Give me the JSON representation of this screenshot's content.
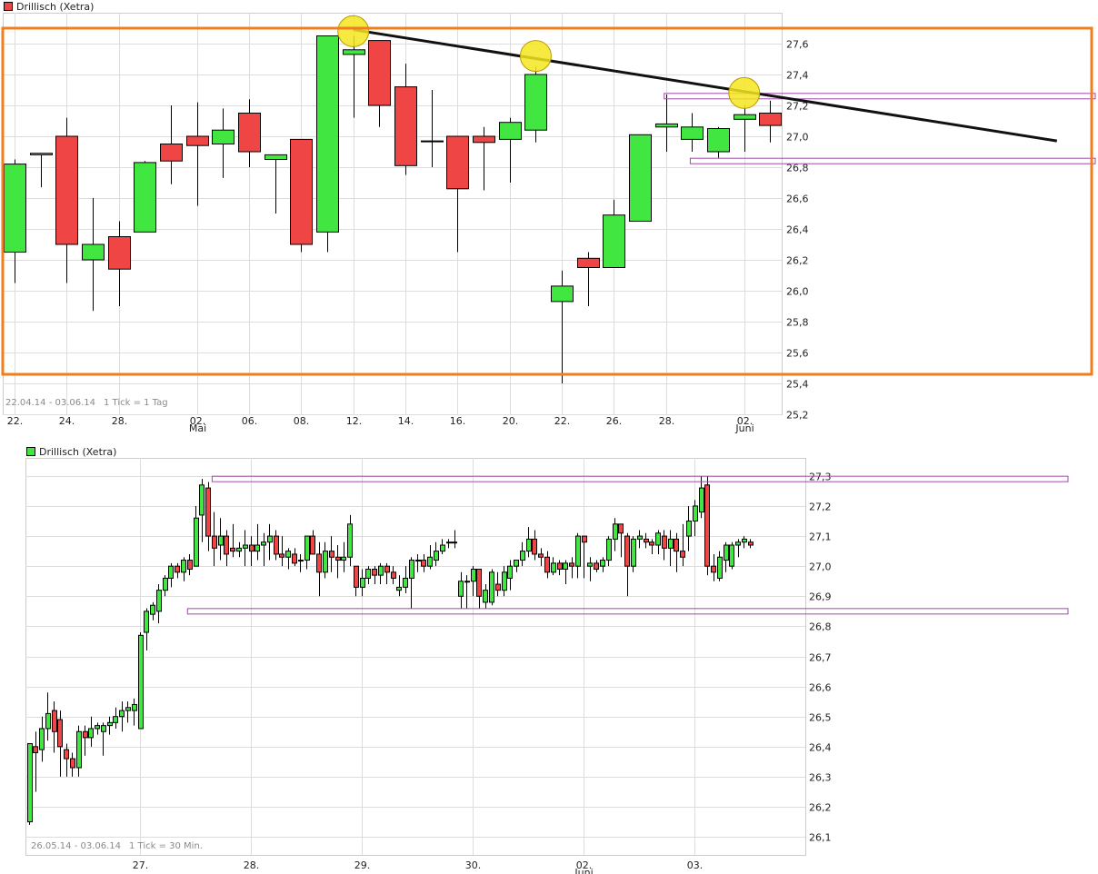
{
  "colors": {
    "up": "#41e641",
    "down": "#f04545",
    "grid": "#dddddd",
    "frame": "#cccccc",
    "annot_orange": "#f07d1e",
    "annot_yellow": "#f5e51e",
    "channel": "#a04aa8"
  },
  "chart_data": [
    {
      "type": "candlestick",
      "legend": "Drillisch (Xetra)",
      "range_text": "22.04.14 - 03.06.14",
      "tick_text": "1 Tick = 1 Tag",
      "ylim": [
        25.2,
        27.8
      ],
      "yticks": [
        "25,2",
        "25,4",
        "25,6",
        "25,8",
        "26,0",
        "26,2",
        "26,4",
        "26,6",
        "26,8",
        "27,0",
        "27,2",
        "27,4",
        "27,6"
      ],
      "xticks": [
        {
          "label": "22.",
          "i": 0
        },
        {
          "label": "24.",
          "i": 2
        },
        {
          "label": "28.",
          "i": 4
        },
        {
          "label": "02.",
          "sub": "Mai",
          "i": 7
        },
        {
          "label": "06.",
          "i": 9
        },
        {
          "label": "08.",
          "i": 11
        },
        {
          "label": "12.",
          "i": 13
        },
        {
          "label": "14.",
          "i": 15
        },
        {
          "label": "16.",
          "i": 17
        },
        {
          "label": "20.",
          "i": 19
        },
        {
          "label": "22.",
          "i": 21
        },
        {
          "label": "26.",
          "i": 23
        },
        {
          "label": "28.",
          "i": 25
        },
        {
          "label": "02.",
          "sub": "Juni",
          "i": 28
        }
      ],
      "candles": [
        [
          26.25,
          26.82,
          26.05,
          26.85
        ],
        [
          26.88,
          26.89,
          26.67,
          26.89
        ],
        [
          27.0,
          26.3,
          26.05,
          27.12
        ],
        [
          26.2,
          26.3,
          25.87,
          26.6
        ],
        [
          26.35,
          26.14,
          25.9,
          26.45
        ],
        [
          26.38,
          26.83,
          26.38,
          26.84
        ],
        [
          26.95,
          26.84,
          26.69,
          27.2
        ],
        [
          27.0,
          26.94,
          26.55,
          27.22
        ],
        [
          26.95,
          27.04,
          26.73,
          27.18
        ],
        [
          27.15,
          26.9,
          26.8,
          27.24
        ],
        [
          26.85,
          26.88,
          26.5,
          26.88
        ],
        [
          26.98,
          26.3,
          26.25,
          26.98
        ],
        [
          26.38,
          27.65,
          26.25,
          27.65
        ],
        [
          27.53,
          27.56,
          27.12,
          27.65
        ],
        [
          27.62,
          27.2,
          27.06,
          27.62
        ],
        [
          27.32,
          26.81,
          26.75,
          27.47
        ],
        [
          26.97,
          26.97,
          26.8,
          27.3
        ],
        [
          27.0,
          26.66,
          26.25,
          27.0
        ],
        [
          27.0,
          26.96,
          26.65,
          27.06
        ],
        [
          26.98,
          27.09,
          26.7,
          27.12
        ],
        [
          27.04,
          27.4,
          26.96,
          27.45
        ],
        [
          25.93,
          26.03,
          25.4,
          26.13
        ],
        [
          26.21,
          26.15,
          25.9,
          26.25
        ],
        [
          26.15,
          26.49,
          26.15,
          26.59
        ],
        [
          26.45,
          27.01,
          26.45,
          27.01
        ],
        [
          27.06,
          27.08,
          26.9,
          27.27
        ],
        [
          26.98,
          27.06,
          26.9,
          27.15
        ],
        [
          26.9,
          27.05,
          26.86,
          27.06
        ],
        [
          27.11,
          27.14,
          26.9,
          27.2
        ],
        [
          27.15,
          27.07,
          26.96,
          27.23
        ]
      ],
      "trendline": [
        [
          13,
          27.69
        ],
        [
          40,
          26.97
        ]
      ],
      "highlights": [
        [
          13,
          27.68
        ],
        [
          20,
          27.52
        ],
        [
          28,
          27.28
        ]
      ],
      "channels": [
        [
          25,
          27.26
        ],
        [
          26,
          26.84
        ]
      ]
    },
    {
      "type": "candlestick",
      "legend": "Drillisch (Xetra)",
      "range_text": "26.05.14 - 03.06.14",
      "tick_text": "1 Tick = 30 Min.",
      "ylim": [
        26.04,
        27.36
      ],
      "yticks": [
        "26,1",
        "26,2",
        "26,3",
        "26,4",
        "26,5",
        "26,6",
        "26,7",
        "26,8",
        "26,9",
        "27,0",
        "27,1",
        "27,2",
        "27,3"
      ],
      "xticks": [
        {
          "label": "27.",
          "i": 18
        },
        {
          "label": "28.",
          "i": 36
        },
        {
          "label": "29.",
          "i": 54
        },
        {
          "label": "30.",
          "i": 72
        },
        {
          "label": "02.",
          "sub": "Juni",
          "i": 90
        },
        {
          "label": "03.",
          "i": 108
        }
      ],
      "candles": [
        [
          26.15,
          26.41,
          26.14,
          26.41
        ],
        [
          26.4,
          26.38,
          26.25,
          26.45
        ],
        [
          26.39,
          26.46,
          26.35,
          26.5
        ],
        [
          26.46,
          26.51,
          26.42,
          26.58
        ],
        [
          26.52,
          26.45,
          26.38,
          26.55
        ],
        [
          26.49,
          26.4,
          26.3,
          26.52
        ],
        [
          26.39,
          26.36,
          26.3,
          26.41
        ],
        [
          26.36,
          26.33,
          26.3,
          26.38
        ],
        [
          26.33,
          26.45,
          26.3,
          26.47
        ],
        [
          26.45,
          26.43,
          26.37,
          26.47
        ],
        [
          26.43,
          26.46,
          26.4,
          26.5
        ],
        [
          26.46,
          26.47,
          26.44,
          26.48
        ],
        [
          26.45,
          26.47,
          26.37,
          26.48
        ],
        [
          26.47,
          26.48,
          26.44,
          26.5
        ],
        [
          26.48,
          26.5,
          26.46,
          26.53
        ],
        [
          26.5,
          26.52,
          26.45,
          26.55
        ],
        [
          26.52,
          26.53,
          26.48,
          26.55
        ],
        [
          26.52,
          26.54,
          26.47,
          26.56
        ],
        [
          26.46,
          26.77,
          26.46,
          26.78
        ],
        [
          26.78,
          26.85,
          26.72,
          26.86
        ],
        [
          26.84,
          26.87,
          26.82,
          26.88
        ],
        [
          26.85,
          26.92,
          26.81,
          26.94
        ],
        [
          26.92,
          26.96,
          26.9,
          26.97
        ],
        [
          26.96,
          27.0,
          26.93,
          27.01
        ],
        [
          27.0,
          26.98,
          26.96,
          27.01
        ],
        [
          26.98,
          27.02,
          26.95,
          27.03
        ],
        [
          27.02,
          26.99,
          26.97,
          27.04
        ],
        [
          27.0,
          27.16,
          27.0,
          27.2
        ],
        [
          27.17,
          27.27,
          27.08,
          27.29
        ],
        [
          27.26,
          27.1,
          27.05,
          27.28
        ],
        [
          27.1,
          27.06,
          27.0,
          27.18
        ],
        [
          27.07,
          27.1,
          27.02,
          27.16
        ],
        [
          27.1,
          27.04,
          27.0,
          27.12
        ],
        [
          27.06,
          27.05,
          27.03,
          27.14
        ],
        [
          27.05,
          27.06,
          27.03,
          27.08
        ],
        [
          27.06,
          27.07,
          27.0,
          27.12
        ],
        [
          27.07,
          27.05,
          27.0,
          27.1
        ],
        [
          27.05,
          27.07,
          27.02,
          27.14
        ],
        [
          27.07,
          27.08,
          27.0,
          27.11
        ],
        [
          27.08,
          27.1,
          27.02,
          27.14
        ],
        [
          27.1,
          27.04,
          27.02,
          27.12
        ],
        [
          27.04,
          27.03,
          27.0,
          27.1
        ],
        [
          27.03,
          27.05,
          26.99,
          27.06
        ],
        [
          27.04,
          27.01,
          27.0,
          27.06
        ],
        [
          27.02,
          27.02,
          26.98,
          27.04
        ],
        [
          27.02,
          27.1,
          26.99,
          27.1
        ],
        [
          27.1,
          27.04,
          27.04,
          27.12
        ],
        [
          27.04,
          26.98,
          26.9,
          27.08
        ],
        [
          26.98,
          27.05,
          26.96,
          27.08
        ],
        [
          27.05,
          27.03,
          26.98,
          27.1
        ],
        [
          27.03,
          27.02,
          26.96,
          27.07
        ],
        [
          27.02,
          27.03,
          26.98,
          27.08
        ],
        [
          27.03,
          27.14,
          27.0,
          27.17
        ],
        [
          27.0,
          26.93,
          26.9,
          27.0
        ],
        [
          26.93,
          26.96,
          26.9,
          26.99
        ],
        [
          26.96,
          26.99,
          26.94,
          27.0
        ],
        [
          26.99,
          26.97,
          26.94,
          27.0
        ],
        [
          26.97,
          27.0,
          26.94,
          27.01
        ],
        [
          27.0,
          26.98,
          26.94,
          27.01
        ],
        [
          26.98,
          26.96,
          26.94,
          27.0
        ],
        [
          26.92,
          26.93,
          26.9,
          26.97
        ],
        [
          26.93,
          26.96,
          26.91,
          27.0
        ],
        [
          26.96,
          27.02,
          26.86,
          27.03
        ],
        [
          27.02,
          27.02,
          26.98,
          27.04
        ],
        [
          27.02,
          27.0,
          26.98,
          27.04
        ],
        [
          27.0,
          27.03,
          26.99,
          27.07
        ],
        [
          27.02,
          27.05,
          27.0,
          27.08
        ],
        [
          27.05,
          27.07,
          27.04,
          27.09
        ],
        [
          27.08,
          27.08,
          27.06,
          27.09
        ],
        [
          27.08,
          27.08,
          27.06,
          27.12
        ],
        [
          26.9,
          26.95,
          26.86,
          26.98
        ],
        [
          26.95,
          26.95,
          26.86,
          26.97
        ],
        [
          26.95,
          26.99,
          26.9,
          27.0
        ],
        [
          26.99,
          26.9,
          26.86,
          26.99
        ],
        [
          26.88,
          26.92,
          26.86,
          26.94
        ],
        [
          26.88,
          26.98,
          26.87,
          26.99
        ],
        [
          26.94,
          26.92,
          26.9,
          26.98
        ],
        [
          26.92,
          26.98,
          26.9,
          27.0
        ],
        [
          26.96,
          27.0,
          26.92,
          27.02
        ],
        [
          27.0,
          27.02,
          26.98,
          27.02
        ],
        [
          27.02,
          27.05,
          27.0,
          27.08
        ],
        [
          27.05,
          27.09,
          27.03,
          27.13
        ],
        [
          27.09,
          27.04,
          27.02,
          27.12
        ],
        [
          27.04,
          27.03,
          27.0,
          27.06
        ],
        [
          27.03,
          26.98,
          26.96,
          27.05
        ],
        [
          26.98,
          27.01,
          26.97,
          27.03
        ],
        [
          27.01,
          26.99,
          26.97,
          27.02
        ],
        [
          26.99,
          27.01,
          26.94,
          27.02
        ],
        [
          27.01,
          27.0,
          26.96,
          27.03
        ],
        [
          27.0,
          27.1,
          26.96,
          27.11
        ],
        [
          27.1,
          27.08,
          26.96,
          27.1
        ],
        [
          27.0,
          27.01,
          26.95,
          27.03
        ],
        [
          27.01,
          26.99,
          26.98,
          27.02
        ],
        [
          27.0,
          27.02,
          26.98,
          27.03
        ],
        [
          27.02,
          27.09,
          27.0,
          27.1
        ],
        [
          27.09,
          27.14,
          27.05,
          27.16
        ],
        [
          27.14,
          27.11,
          27.03,
          27.14
        ],
        [
          27.1,
          27.0,
          26.9,
          27.11
        ],
        [
          27.0,
          27.09,
          26.98,
          27.1
        ],
        [
          27.09,
          27.1,
          27.06,
          27.12
        ],
        [
          27.09,
          27.08,
          27.06,
          27.11
        ],
        [
          27.08,
          27.07,
          27.04,
          27.09
        ],
        [
          27.07,
          27.11,
          27.04,
          27.12
        ],
        [
          27.1,
          27.06,
          27.02,
          27.12
        ],
        [
          27.06,
          27.09,
          27.0,
          27.12
        ],
        [
          27.09,
          27.05,
          26.98,
          27.11
        ],
        [
          27.05,
          27.03,
          27.0,
          27.14
        ],
        [
          27.1,
          27.15,
          27.05,
          27.2
        ],
        [
          27.15,
          27.2,
          27.1,
          27.22
        ],
        [
          27.18,
          27.26,
          27.16,
          27.3
        ],
        [
          27.27,
          27.0,
          26.97,
          27.3
        ],
        [
          27.0,
          26.98,
          26.95,
          27.04
        ],
        [
          26.96,
          27.03,
          26.95,
          27.05
        ],
        [
          27.02,
          27.07,
          26.98,
          27.08
        ],
        [
          27.0,
          27.07,
          26.99,
          27.08
        ],
        [
          27.07,
          27.08,
          27.03,
          27.09
        ],
        [
          27.08,
          27.09,
          27.06,
          27.1
        ],
        [
          27.08,
          27.07,
          27.06,
          27.09
        ]
      ],
      "channels": [
        [
          30,
          27.29
        ],
        [
          26,
          26.85
        ]
      ]
    }
  ]
}
